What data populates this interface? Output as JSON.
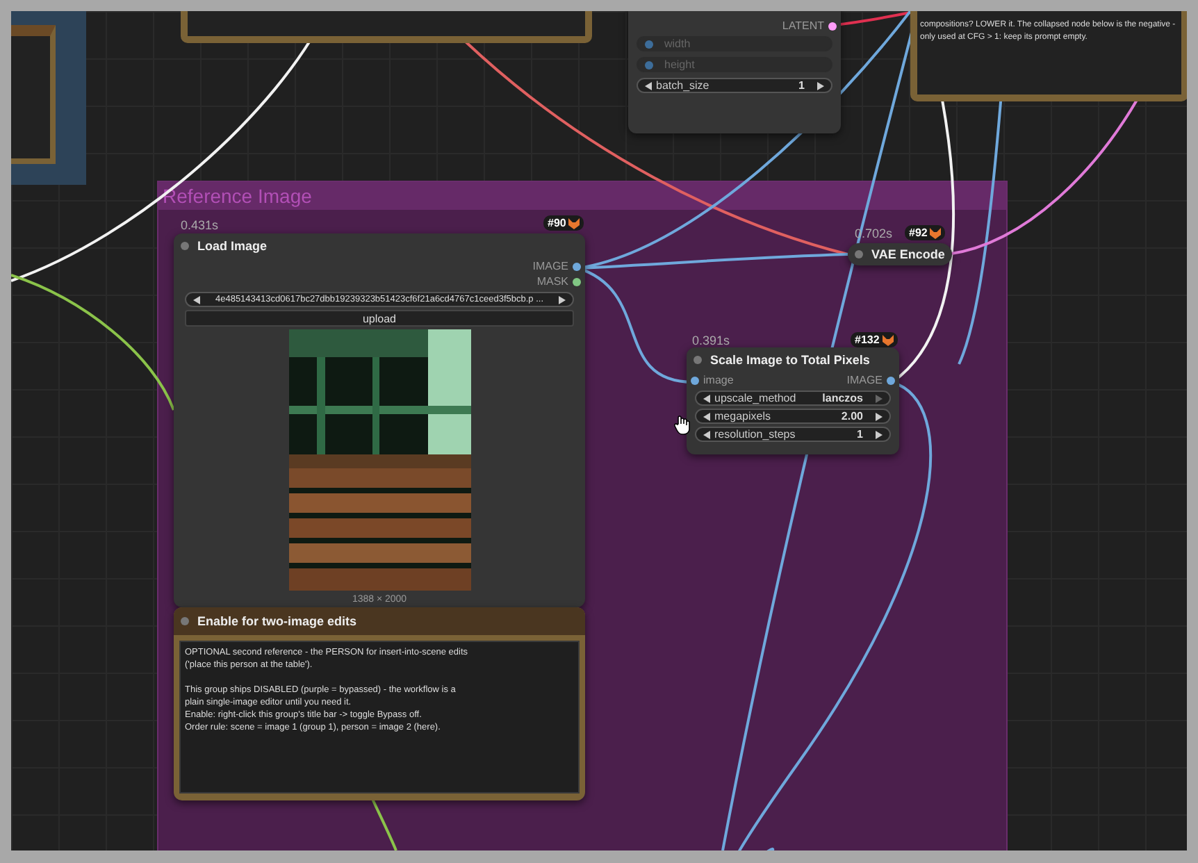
{
  "top_note": {
    "lines": [
      "compositions? LOWER it. The collapsed node below is the negative -",
      "only used at CFG > 1: keep its prompt empty."
    ]
  },
  "latent_node": {
    "output": "LATENT",
    "widgets": [
      {
        "kind": "input",
        "name": "width"
      },
      {
        "kind": "input",
        "name": "height"
      },
      {
        "kind": "number",
        "name": "batch_size",
        "value": "1"
      }
    ]
  },
  "group": {
    "title": "Reference Image"
  },
  "load_image": {
    "time": "0.431s",
    "id": "#90",
    "title": "Load Image",
    "outputs": [
      {
        "name": "IMAGE",
        "color": "#6fa8dc"
      },
      {
        "name": "MASK",
        "color": "#81c784"
      }
    ],
    "file": "4e485143413cd0617bc27dbb19239323b51423cf6f21a6cd4767c1ceed3f5bcb.p ...",
    "upload": "upload",
    "size": "1388 × 2000"
  },
  "enable_node": {
    "title": "Enable for two-image edits",
    "paragraphs": [
      [
        "OPTIONAL second reference - the PERSON for insert-into-scene edits",
        "('place this person at the table')."
      ],
      [
        "This group ships DISABLED (purple = bypassed) - the workflow is a",
        "plain single-image editor until you need it.",
        "Enable: right-click this group's title bar -> toggle Bypass off.",
        "Order rule: scene = image 1 (group 1), person = image 2 (here)."
      ]
    ]
  },
  "vae_encode": {
    "time": "0.702s",
    "id": "#92",
    "title": "VAE Encode"
  },
  "scale_node": {
    "time": "0.391s",
    "id": "#132",
    "title": "Scale Image to Total Pixels",
    "input": "image",
    "output": "IMAGE",
    "widgets": [
      {
        "kind": "combo",
        "name": "upscale_method",
        "value": "lanczos"
      },
      {
        "kind": "number",
        "name": "megapixels",
        "value": "2.00"
      },
      {
        "kind": "number",
        "name": "resolution_steps",
        "value": "1"
      }
    ]
  }
}
